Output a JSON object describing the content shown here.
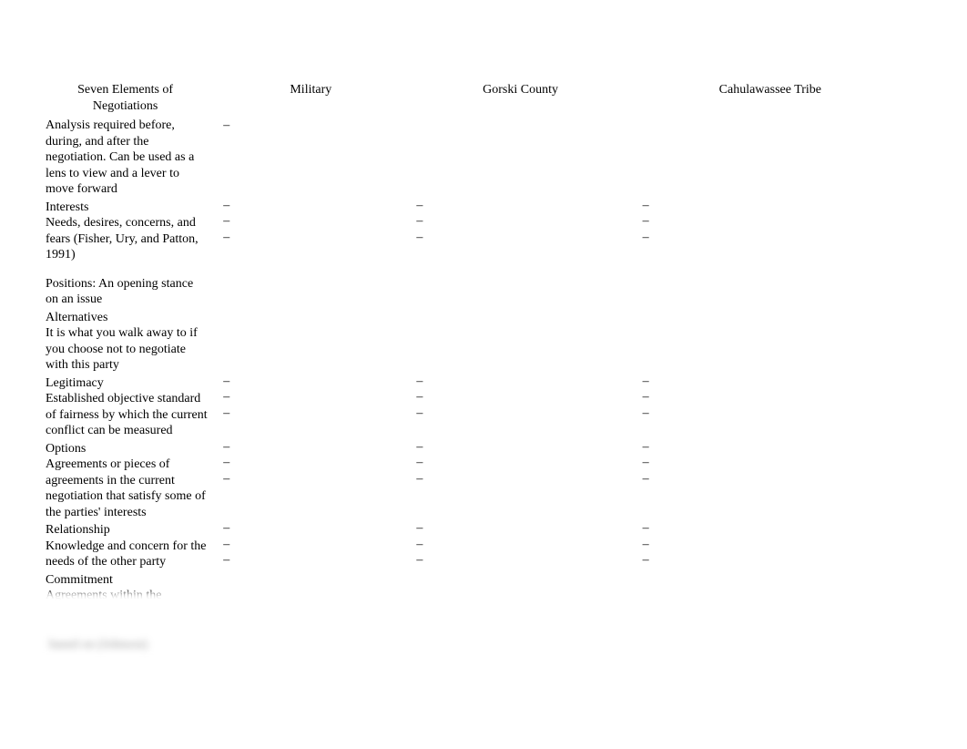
{
  "headers": {
    "col1": "Seven Elements of Negotiations",
    "col2": "Military",
    "col3": "Gorski County",
    "col4": "Cahulawassee Tribe"
  },
  "dash": "–",
  "rows": {
    "analysis": {
      "title": "",
      "desc": "Analysis required before, during, and after the negotiation. Can be used as a lens to view and a lever to move forward",
      "c2": "–",
      "c3": "",
      "c4": ""
    },
    "interests": {
      "title": "Interests",
      "desc_line1": "Needs, desires, concerns, and fears (Fisher, Ury, and Patton, 1991)",
      "desc_line2": "Positions: An opening stance on an issue",
      "c2": "–\n–\n–",
      "c3": "–\n–\n–",
      "c4": "–\n–\n–"
    },
    "alternatives": {
      "title": "Alternatives",
      "desc": "It is what you walk away to if you choose not to negotiate with this party",
      "c2": "",
      "c3": "",
      "c4": ""
    },
    "legitimacy": {
      "title": "Legitimacy",
      "desc": "Established objective standard of fairness by which the current conflict can be measured",
      "c2": "–\n–\n–",
      "c3": "–\n–\n–",
      "c4": "–\n–\n–"
    },
    "options": {
      "title": "Options",
      "desc": "Agreements or pieces of agreements in the current negotiation that satisfy some of the parties' interests",
      "c2": "–\n–\n–",
      "c3": "–\n–\n–",
      "c4": "–\n–\n–"
    },
    "relationship": {
      "title": "Relationship",
      "desc": "Knowledge and concern for the needs of the other party",
      "c2": "–\n–\n–",
      "c3": "–\n–\n–",
      "c4": "–\n–\n–"
    },
    "commitment": {
      "title": "Commitment",
      "desc": "Agreements within the",
      "c2": "",
      "c3": "",
      "c4": ""
    }
  },
  "blurred_text": "based on (Johnson)"
}
